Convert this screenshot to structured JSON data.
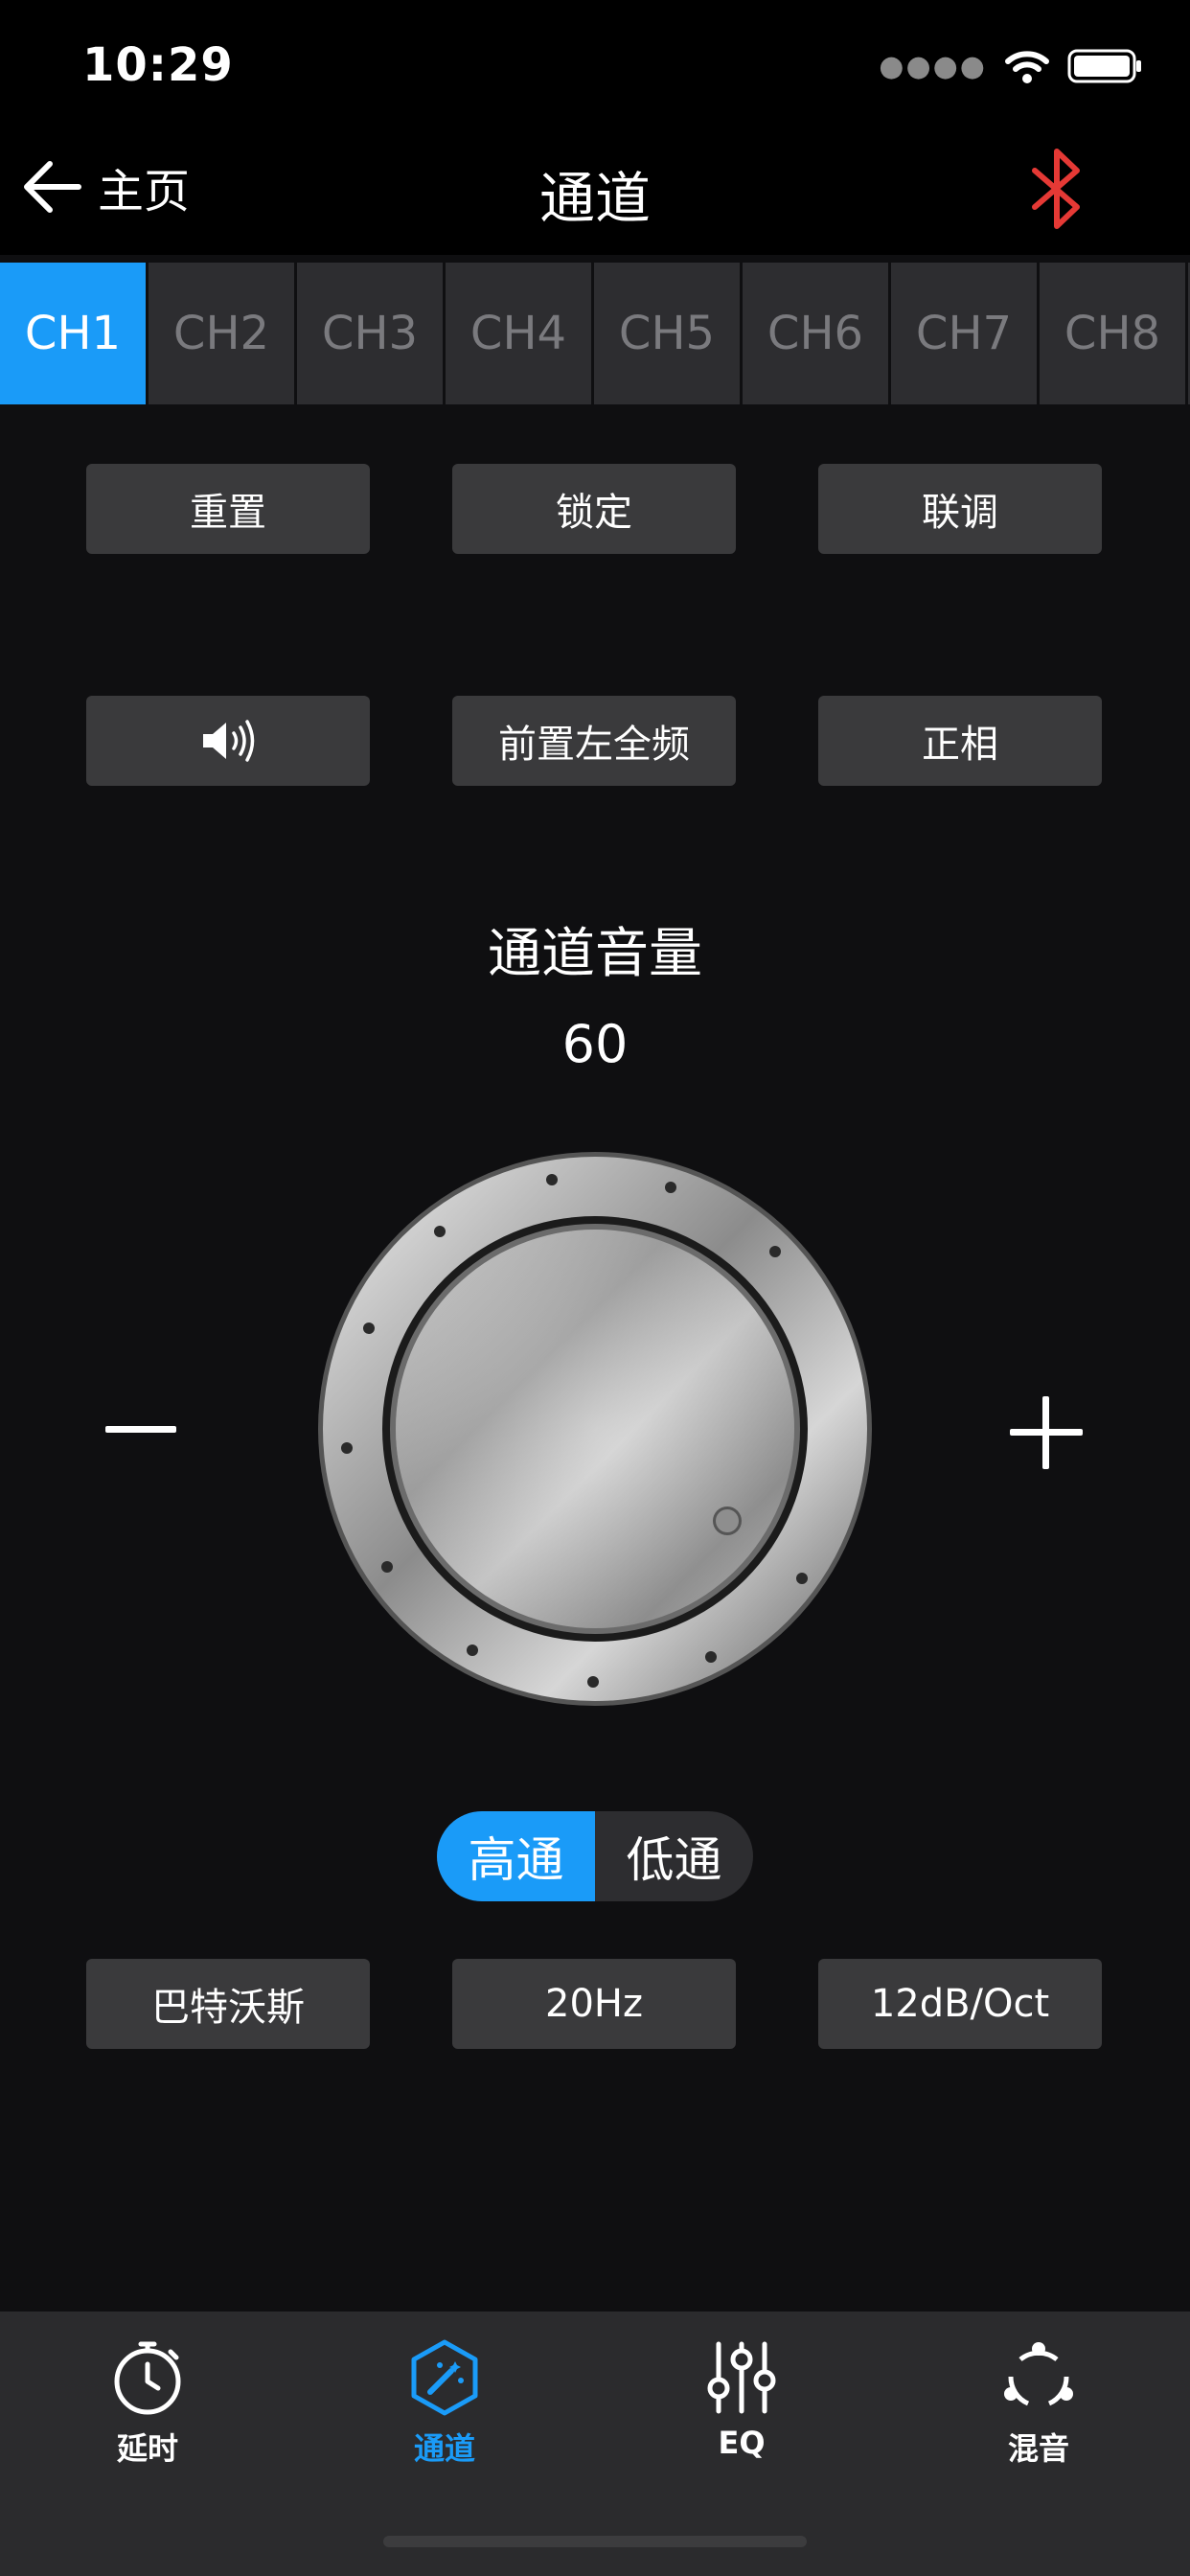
{
  "status": {
    "time": "10:29"
  },
  "nav": {
    "back_label": "主页",
    "title": "通道",
    "bluetooth_color": "#e53935"
  },
  "channels": [
    "CH1",
    "CH2",
    "CH3",
    "CH4",
    "CH5",
    "CH6",
    "CH7",
    "CH8"
  ],
  "active_channel": "CH1",
  "actions": {
    "reset": "重置",
    "lock": "锁定",
    "link": "联调"
  },
  "channel_opts": {
    "position": "前置左全频",
    "phase": "正相"
  },
  "volume": {
    "label": "通道音量",
    "value": "60"
  },
  "filter": {
    "tabs": [
      "高通",
      "低通"
    ],
    "active": "高通",
    "type": "巴特沃斯",
    "freq": "20Hz",
    "slope": "12dB/Oct"
  },
  "tabbar": [
    {
      "label": "延时",
      "icon": "stopwatch-icon"
    },
    {
      "label": "通道",
      "icon": "magic-wand-icon"
    },
    {
      "label": "EQ",
      "icon": "sliders-icon"
    },
    {
      "label": "混音",
      "icon": "mix-icon"
    }
  ],
  "accent_color": "#1a9bf8"
}
